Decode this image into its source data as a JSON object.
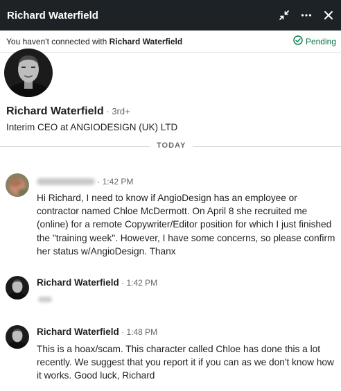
{
  "header": {
    "title": "Richard Waterfield",
    "icons": [
      "minimize-icon",
      "more-icon",
      "close-icon"
    ]
  },
  "connection": {
    "prefix": "You haven't connected with ",
    "name": "Richard Waterfield",
    "status": "Pending",
    "status_color": "#057642"
  },
  "profile": {
    "name": "Richard Waterfield",
    "degree": " · 3rd+",
    "headline": "Interim CEO at ANGIODESIGN (UK) LTD"
  },
  "divider_label": "TODAY",
  "messages": [
    {
      "time": " · 1:42 PM",
      "text": "Hi Richard, I need to know if AngioDesign has an employee or contractor named Chloe McDermott. On April 8 she recruited me (online) for a remote Copywriter/Editor position for which I just finished the \"training week\". However, I have some concerns, so please confirm her status w/AngioDesign. Thanx"
    },
    {
      "sender": "Richard Waterfield",
      "time": " · 1:42 PM"
    },
    {
      "sender": "Richard Waterfield",
      "time": " · 1:48 PM",
      "text": "This is a hoax/scam. This character called Chloe has done this a lot recently. We suggest that you report it if you can as we don't know how it works. Good luck, Richard"
    }
  ],
  "colors": {
    "header_bg": "#1d2226",
    "pending": "#057642"
  }
}
